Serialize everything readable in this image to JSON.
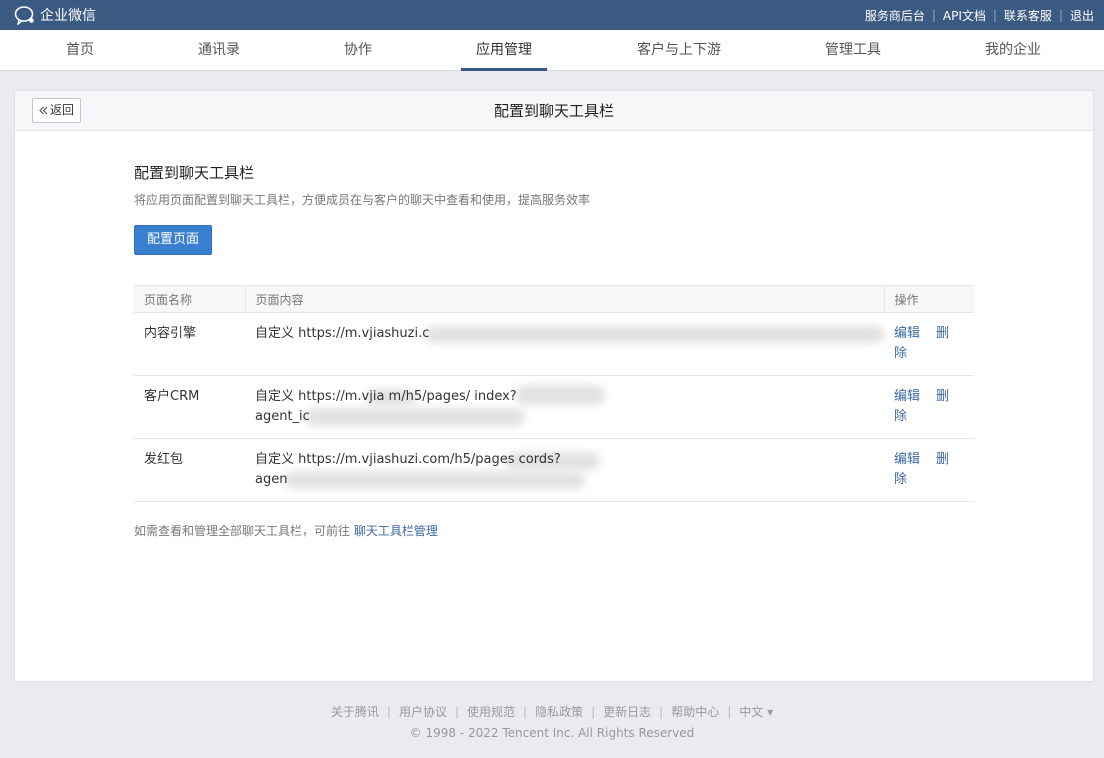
{
  "topbar": {
    "brand": "企业微信",
    "links": [
      "服务商后台",
      "API文档",
      "联系客服",
      "退出"
    ]
  },
  "nav": {
    "items": [
      "首页",
      "通讯录",
      "协作",
      "应用管理",
      "客户与上下游",
      "管理工具",
      "我的企业"
    ],
    "active": "应用管理"
  },
  "card": {
    "back_label": "返回",
    "title": "配置到聊天工具栏"
  },
  "section": {
    "title": "配置到聊天工具栏",
    "description": "将应用页面配置到聊天工具栏，方便成员在与客户的聊天中查看和使用，提高服务效率",
    "button": "配置页面"
  },
  "table": {
    "headers": [
      "页面名称",
      "页面内容",
      "操作"
    ],
    "rows": [
      {
        "name": "内容引擎",
        "line1": "自定义  https://m.vjiashuzi.c",
        "line2": "",
        "edit": "编辑",
        "delete": "删除"
      },
      {
        "name": "客户CRM",
        "line1": "自定义  https://m.vjia      m/h5/pages/                index?",
        "line2": "agent_ic",
        "edit": "编辑",
        "delete": "删除"
      },
      {
        "name": "发红包",
        "line1": "自定义  https://m.vjiashuzi.com/h5/pages                   cords?",
        "line2": "agen",
        "edit": "编辑",
        "delete": "删除"
      }
    ]
  },
  "note": {
    "text": "如需查看和管理全部聊天工具栏，可前往",
    "link": "聊天工具栏管理"
  },
  "footer": {
    "links": [
      "关于腾讯",
      "用户协议",
      "使用规范",
      "隐私政策",
      "更新日志",
      "帮助中心",
      "中文 ▾"
    ],
    "copyright": "© 1998 - 2022 Tencent Inc. All Rights Reserved"
  },
  "colors": {
    "topbar": "#3b5a82",
    "primary": "#3a7fcf",
    "link": "#3b6aa3"
  }
}
